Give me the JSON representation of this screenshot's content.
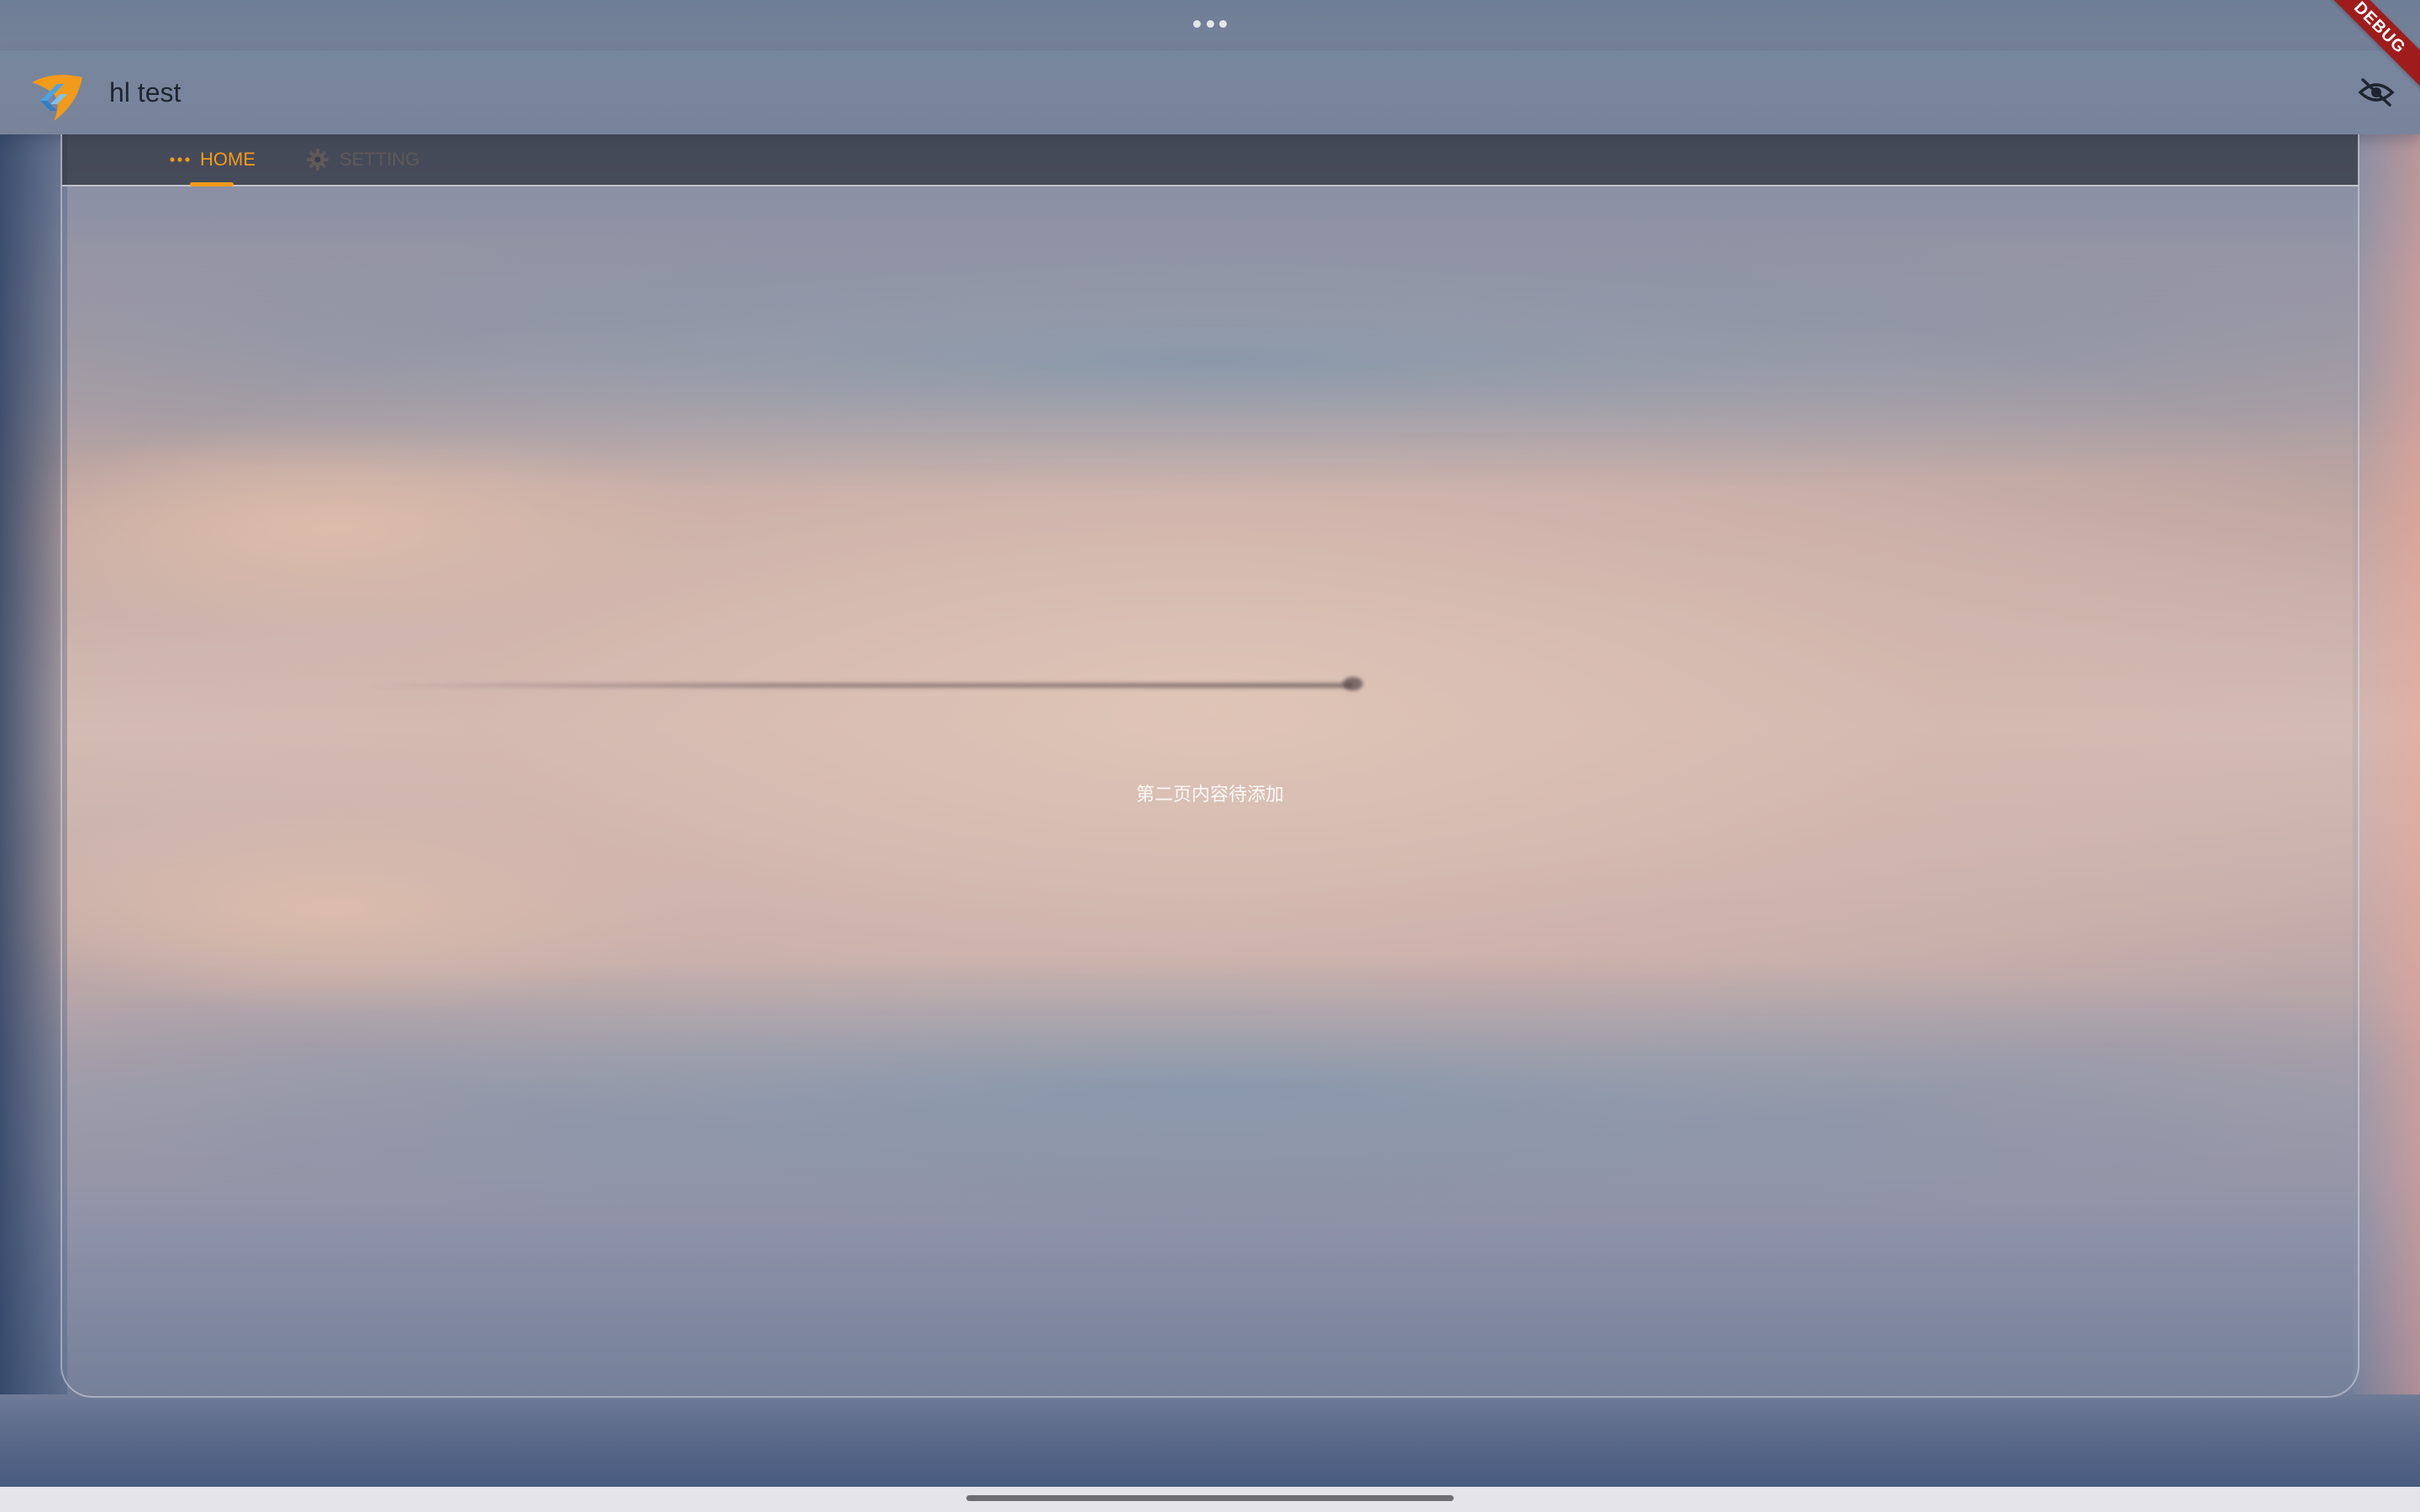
{
  "app": {
    "title": "hl test",
    "debug_label": "DEBUG"
  },
  "appbar": {
    "action_icon": "eye-slash-icon"
  },
  "tabs": [
    {
      "label": "HOME",
      "icon": "more-horiz-icon",
      "selected": true
    },
    {
      "label": "SETTING",
      "icon": "gear-icon",
      "selected": false
    }
  ],
  "content": {
    "message": "第二页内容待添加"
  },
  "colors": {
    "accent": "#f29a1a",
    "debug_banner": "#a01c1c",
    "tab_bar_bg": "#2d303c"
  }
}
